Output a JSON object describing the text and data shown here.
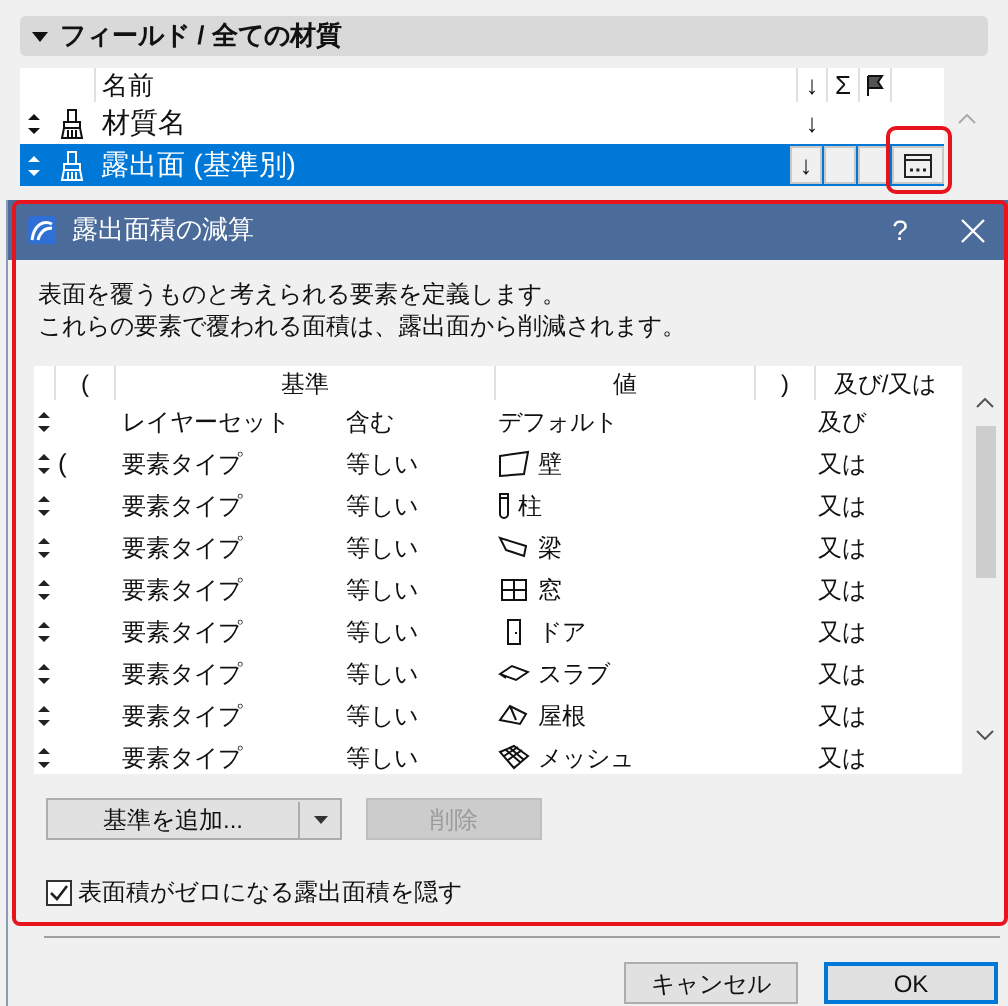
{
  "section": {
    "title": "フィールド /  全ての材質",
    "expanded": true
  },
  "fields_table": {
    "columns": [
      "名前",
      "↓",
      "Σ"
    ],
    "rows": [
      {
        "name": "材質名",
        "sort": "↓",
        "selected": false
      },
      {
        "name": "露出面 (基準別)",
        "sort": "↓",
        "selected": true
      }
    ]
  },
  "dialog": {
    "title": "露出面積の減算",
    "help": "?",
    "description": [
      "表面を覆うものと考えられる要素を定義します。",
      "これらの要素で覆われる面積は、露出面から削減されます。"
    ],
    "criteria_table": {
      "columns": [
        "(",
        "基準",
        "値",
        ")",
        "及び/又は"
      ],
      "rows": [
        {
          "open_paren": "",
          "criterion": "レイヤーセット",
          "operator": "含む",
          "value": "デフォルト",
          "conjunction": "及び"
        },
        {
          "open_paren": "(",
          "criterion": "要素タイプ",
          "operator": "等しい",
          "value": "壁",
          "kind": "wall",
          "conjunction": "又は"
        },
        {
          "open_paren": "",
          "criterion": "要素タイプ",
          "operator": "等しい",
          "value": "柱",
          "kind": "column",
          "conjunction": "又は"
        },
        {
          "open_paren": "",
          "criterion": "要素タイプ",
          "operator": "等しい",
          "value": "梁",
          "kind": "beam",
          "conjunction": "又は"
        },
        {
          "open_paren": "",
          "criterion": "要素タイプ",
          "operator": "等しい",
          "value": "窓",
          "kind": "window",
          "conjunction": "又は"
        },
        {
          "open_paren": "",
          "criterion": "要素タイプ",
          "operator": "等しい",
          "value": "ドア",
          "kind": "door",
          "conjunction": "又は"
        },
        {
          "open_paren": "",
          "criterion": "要素タイプ",
          "operator": "等しい",
          "value": "スラブ",
          "kind": "slab",
          "conjunction": "又は"
        },
        {
          "open_paren": "",
          "criterion": "要素タイプ",
          "operator": "等しい",
          "value": "屋根",
          "kind": "roof",
          "conjunction": "又は"
        },
        {
          "open_paren": "",
          "criterion": "要素タイプ",
          "operator": "等しい",
          "value": "メッシュ",
          "kind": "mesh",
          "conjunction": "又は"
        }
      ]
    },
    "add_button": "基準を追加...",
    "delete_button": {
      "label": "削除",
      "disabled": true
    },
    "hide_zero_checkbox": {
      "label": "表面積がゼロになる露出面積を隠す",
      "checked": true
    },
    "buttons": [
      {
        "label": "キャンセル",
        "default": false
      },
      {
        "label": "OK",
        "default": true
      }
    ]
  }
}
